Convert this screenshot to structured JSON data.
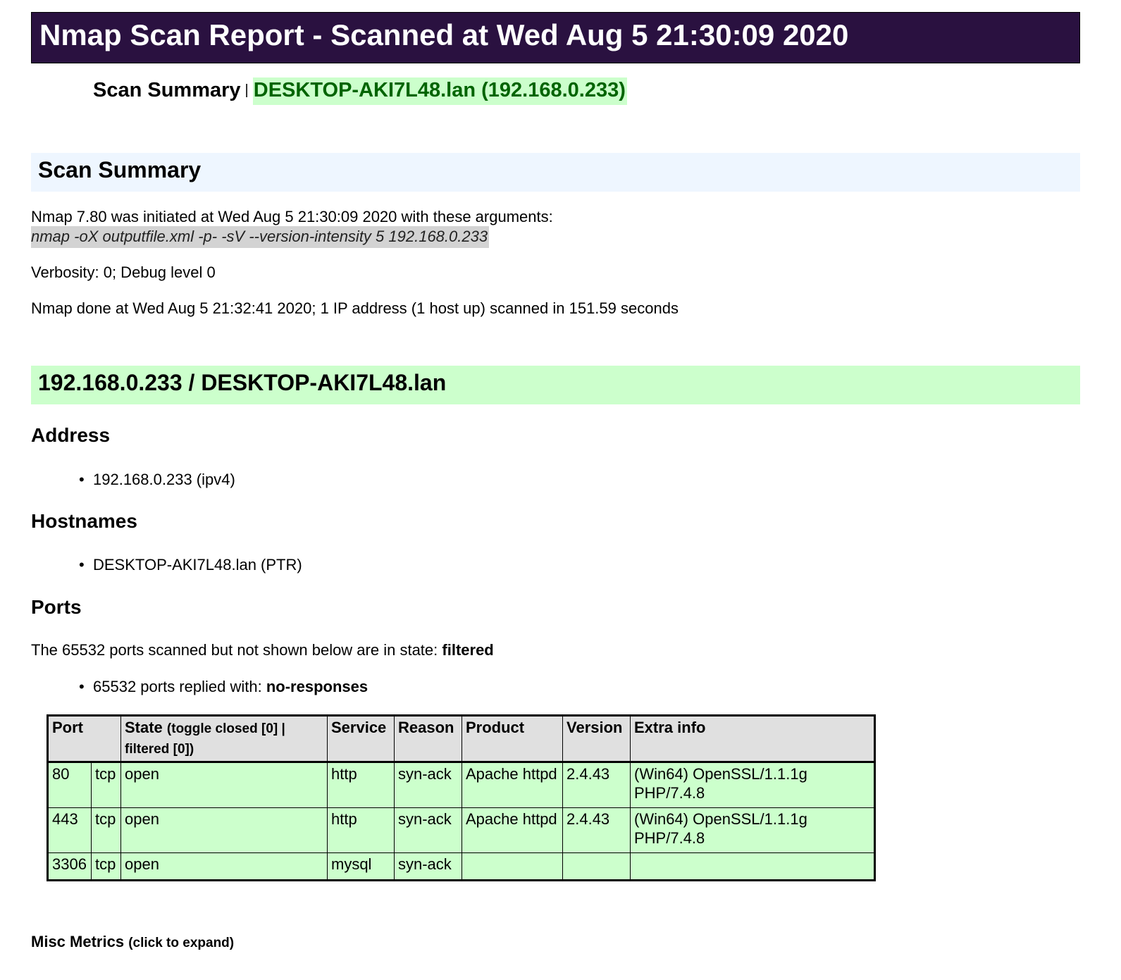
{
  "report_title": "Nmap Scan Report - Scanned at Wed Aug 5 21:30:09 2020",
  "toc": {
    "summary_link": "Scan Summary",
    "separator": "|",
    "host_link": "DESKTOP-AKI7L48.lan (192.168.0.233)"
  },
  "summary": {
    "heading": "Scan Summary",
    "initiated_line": "Nmap 7.80 was initiated at Wed Aug 5 21:30:09 2020 with these arguments:",
    "arguments": "nmap -oX outputfile.xml -p- -sV --version-intensity 5 192.168.0.233",
    "verbosity": "Verbosity: 0; Debug level 0",
    "done_line": "Nmap done at Wed Aug 5 21:32:41 2020; 1 IP address (1 host up) scanned in 151.59 seconds"
  },
  "host": {
    "heading": "192.168.0.233 / DESKTOP-AKI7L48.lan",
    "address_heading": "Address",
    "address_item": "192.168.0.233 (ipv4)",
    "hostnames_heading": "Hostnames",
    "hostname_item": "DESKTOP-AKI7L48.lan (PTR)",
    "ports_heading": "Ports",
    "extraports_text": "The 65532 ports scanned but not shown below are in state: ",
    "extraports_state": "filtered",
    "reason_text": "65532 ports replied with: ",
    "reason_value": "no-responses"
  },
  "ports_table": {
    "headers": {
      "port": "Port",
      "state": "State",
      "toggle_open": "(toggle closed [0] |",
      "toggle_filtered": "filtered [0])",
      "service": "Service",
      "reason": "Reason",
      "product": "Product",
      "version": "Version",
      "extra": "Extra info"
    },
    "rows": [
      {
        "port": "80",
        "proto": "tcp",
        "state": "open",
        "service": "http",
        "reason": "syn-ack",
        "product": "Apache httpd",
        "version": "2.4.43",
        "extra": "(Win64) OpenSSL/1.1.1g PHP/7.4.8"
      },
      {
        "port": "443",
        "proto": "tcp",
        "state": "open",
        "service": "http",
        "reason": "syn-ack",
        "product": "Apache httpd",
        "version": "2.4.43",
        "extra": "(Win64) OpenSSL/1.1.1g PHP/7.4.8"
      },
      {
        "port": "3306",
        "proto": "tcp",
        "state": "open",
        "service": "mysql",
        "reason": "syn-ack",
        "product": "",
        "version": "",
        "extra": ""
      }
    ]
  },
  "misc": {
    "label": "Misc Metrics",
    "hint": "(click to expand)"
  }
}
